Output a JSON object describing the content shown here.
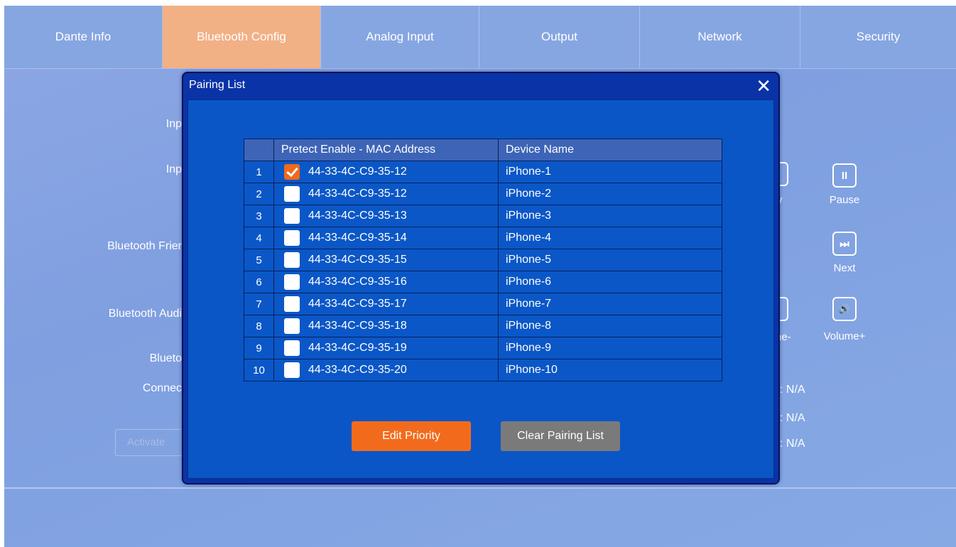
{
  "tabs": [
    {
      "label": "Dante Info"
    },
    {
      "label": "Bluetooth Config"
    },
    {
      "label": "Analog Input"
    },
    {
      "label": "Output"
    },
    {
      "label": "Network"
    },
    {
      "label": "Security"
    }
  ],
  "active_tab": "Bluetooth Config",
  "background": {
    "labels": [
      "Inp",
      "Inp",
      "Bluetooth Frier",
      "Bluetooth Audi",
      "Blueto",
      "Connec"
    ],
    "activate_button": "Activate",
    "controls": {
      "pause": {
        "label": "Pause",
        "glyph": "II"
      },
      "next": {
        "label": "Next",
        "glyph": "⏭"
      },
      "volume_up": {
        "label": "Volume+",
        "glyph": "🔊"
      },
      "play_partial": "y",
      "volume_down_partial": "ne-"
    },
    "values": [
      ": N/A",
      ": N/A",
      ": N/A"
    ]
  },
  "modal": {
    "title": "Pairing List",
    "close_glyph": "✕",
    "table": {
      "headers": {
        "index": "",
        "mac": "Pretect Enable - MAC Address",
        "name": "Device Name"
      },
      "rows": [
        {
          "index": "1",
          "checked": true,
          "mac": "44-33-4C-C9-35-12",
          "name": "iPhone-1"
        },
        {
          "index": "2",
          "checked": false,
          "mac": "44-33-4C-C9-35-12",
          "name": "iPhone-2"
        },
        {
          "index": "3",
          "checked": false,
          "mac": "44-33-4C-C9-35-13",
          "name": "iPhone-3"
        },
        {
          "index": "4",
          "checked": false,
          "mac": "44-33-4C-C9-35-14",
          "name": "iPhone-4"
        },
        {
          "index": "5",
          "checked": false,
          "mac": "44-33-4C-C9-35-15",
          "name": "iPhone-5"
        },
        {
          "index": "6",
          "checked": false,
          "mac": "44-33-4C-C9-35-16",
          "name": "iPhone-6"
        },
        {
          "index": "7",
          "checked": false,
          "mac": "44-33-4C-C9-35-17",
          "name": "iPhone-7"
        },
        {
          "index": "8",
          "checked": false,
          "mac": "44-33-4C-C9-35-18",
          "name": "iPhone-8"
        },
        {
          "index": "9",
          "checked": false,
          "mac": "44-33-4C-C9-35-19",
          "name": "iPhone-9"
        },
        {
          "index": "10",
          "checked": false,
          "mac": "44-33-4C-C9-35-20",
          "name": "iPhone-10"
        }
      ]
    },
    "buttons": {
      "edit_priority": "Edit Priority",
      "clear_pairing_list": "Clear Pairing List"
    }
  },
  "colors": {
    "active_tab": "#f2b085",
    "modal_bg": "#0a33a8",
    "edit_button": "#f26b1d",
    "clear_button": "#7a7a7a"
  }
}
